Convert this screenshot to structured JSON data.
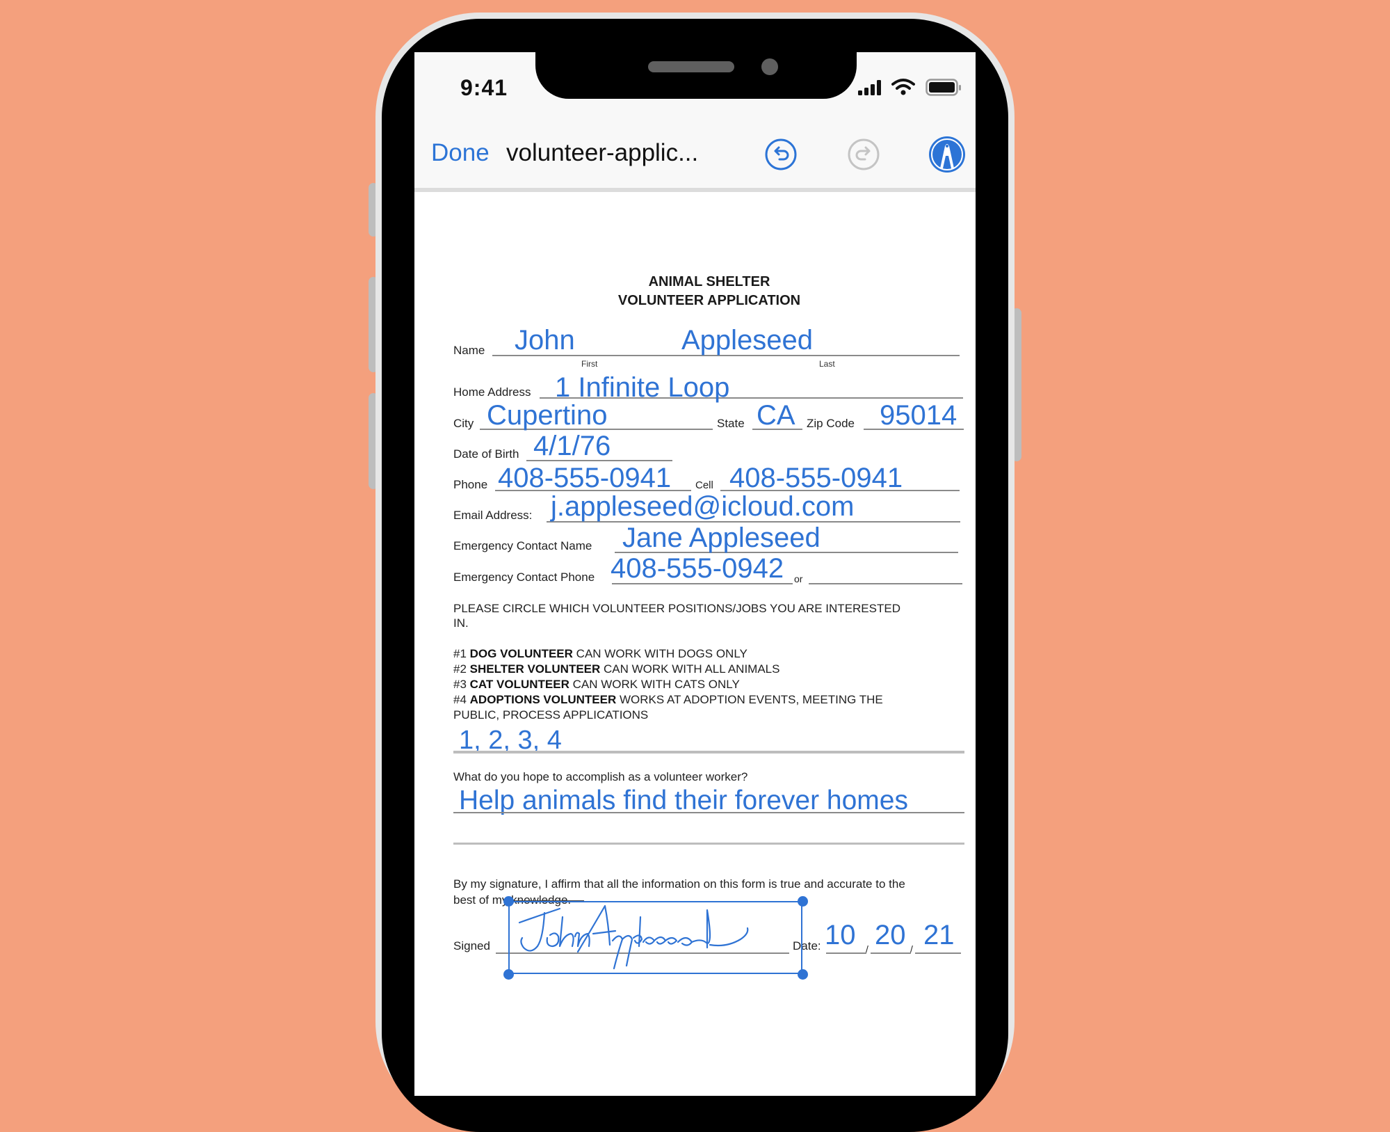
{
  "status_bar": {
    "time": "9:41",
    "icons": [
      "signal-icon",
      "wifi-icon",
      "battery-icon"
    ]
  },
  "toolbar": {
    "done_label": "Done",
    "document_title": "volunteer-applic...",
    "icons": [
      "undo-icon",
      "redo-icon",
      "markup-icon"
    ],
    "accent_color": "#2c74d6"
  },
  "form": {
    "title_line1": "ANIMAL SHELTER",
    "title_line2": "VOLUNTEER APPLICATION",
    "labels": {
      "name": "Name",
      "first": "First",
      "last": "Last",
      "home_address": "Home Address",
      "city": "City",
      "state": "State",
      "zip": "Zip Code",
      "dob": "Date of Birth",
      "phone": "Phone",
      "cell": "Cell",
      "email": "Email Address:",
      "emergency_name": "Emergency Contact Name",
      "emergency_phone": "Emergency Contact Phone",
      "or": "or",
      "signed": "Signed",
      "date": "Date:"
    },
    "values": {
      "first_name": "John",
      "last_name": "Appleseed",
      "home_address": "1 Infinite Loop",
      "city": "Cupertino",
      "state": "CA",
      "zip": "95014",
      "dob": "4/1/76",
      "phone": "408-555-0941",
      "cell": "408-555-0941",
      "email": "j.appleseed@icloud.com",
      "emergency_name": "Jane Appleseed",
      "emergency_phone": "408-555-0942",
      "positions": "1, 2, 3, 4",
      "goal": "Help animals find their forever homes",
      "date_month": "10",
      "date_day": "20",
      "date_year": "21",
      "signature": "John Appleseed"
    },
    "positions_instruction_1": "PLEASE CIRCLE WHICH VOLUNTEER POSITIONS/JOBS YOU ARE INTERESTED",
    "positions_instruction_2": "IN.",
    "positions": [
      {
        "num": "#1 ",
        "name": "DOG VOLUNTEER",
        "desc": " CAN WORK WITH DOGS ONLY"
      },
      {
        "num": "#2 ",
        "name": "SHELTER VOLUNTEER",
        "desc": " CAN WORK WITH ALL ANIMALS"
      },
      {
        "num": "#3 ",
        "name": "CAT VOLUNTEER",
        "desc": " CAN WORK WITH CATS ONLY"
      },
      {
        "num": "#4 ",
        "name": "ADOPTIONS VOLUNTEER",
        "desc": " WORKS AT ADOPTION EVENTS, MEETING THE"
      }
    ],
    "positions_continuation": "PUBLIC, PROCESS APPLICATIONS",
    "goal_question": "What do you hope to accomplish as a volunteer worker?",
    "affirmation_1": "By my signature, I affirm that all the information on this form is true and accurate to the",
    "affirmation_2": "best of my knowledge."
  },
  "colors": {
    "background": "#f4a07d",
    "ink": "#2f73d4"
  }
}
